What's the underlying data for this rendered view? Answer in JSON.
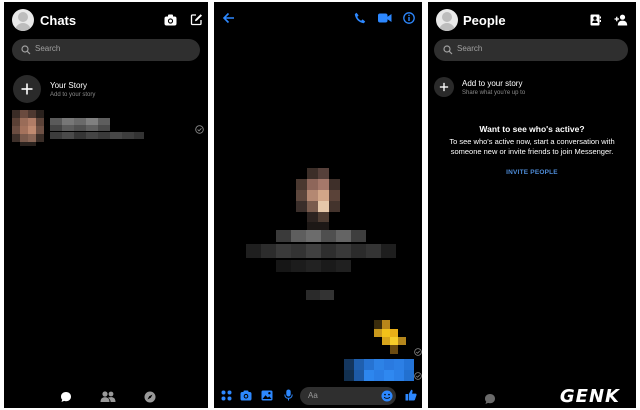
{
  "chats_panel": {
    "title": "Chats",
    "search_placeholder": "Search",
    "story": {
      "title": "Your Story",
      "subtitle": "Add to your story"
    },
    "icons": [
      "camera-icon",
      "compose-icon",
      "chat-bubble-icon",
      "people-icon",
      "compass-icon"
    ]
  },
  "conversation_panel": {
    "input_placeholder": "Aa",
    "icons": [
      "back-arrow-icon",
      "phone-icon",
      "video-icon",
      "info-icon",
      "apps-icon",
      "camera-icon",
      "image-icon",
      "microphone-icon",
      "emoji-icon",
      "like-icon"
    ]
  },
  "people_panel": {
    "title": "People",
    "search_placeholder": "Search",
    "add_story": {
      "title": "Add to your story",
      "subtitle": "Share what you're up to"
    },
    "empty_title": "Want to see who's active?",
    "empty_description": "To see who's active now, start a conversation with someone new or invite friends to join Messenger.",
    "invite_label": "INVITE PEOPLE",
    "icons": [
      "contacts-icon",
      "add-person-icon"
    ]
  },
  "watermark": "GENK",
  "colors": {
    "background": "#000000",
    "accent": "#2d88ff",
    "search_bg": "#2f2f2f",
    "link": "#4e8cd8"
  }
}
